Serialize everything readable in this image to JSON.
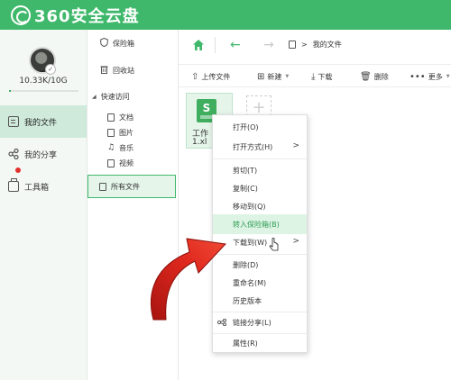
{
  "app": {
    "title": "360安全云盘",
    "brand_color": "#3fb86b"
  },
  "user": {
    "quota": "10.33K/10G",
    "quota_fraction": 0.001
  },
  "nav": {
    "items": [
      {
        "label": "我的文件",
        "icon": "document-icon",
        "active": true
      },
      {
        "label": "我的分享",
        "icon": "share-icon",
        "active": false
      },
      {
        "label": "工具箱",
        "icon": "toolbox-icon",
        "active": false,
        "badge": "red-dot"
      }
    ]
  },
  "tree": {
    "safe": "保险箱",
    "recycle": "回收站",
    "quick_access": "快速访问",
    "categories": [
      "文档",
      "图片",
      "音乐",
      "视频"
    ],
    "all_files": "所有文件"
  },
  "breadcrumb": {
    "current": "我的文件",
    "separator": ">"
  },
  "toolbar": {
    "upload": "上传文件",
    "new": "新建",
    "download": "下载",
    "delete": "删除",
    "more": "更多"
  },
  "file": {
    "name_line1": "工作",
    "name_line2": "1.xl",
    "type": "spreadsheet-icon",
    "type_letter": "S"
  },
  "context_menu": {
    "items": [
      {
        "label": "打开(O)"
      },
      {
        "label": "打开方式(H)",
        "submenu": true
      },
      {
        "label": "剪切(T)"
      },
      {
        "label": "复制(C)"
      },
      {
        "label": "移动到(Q)"
      },
      {
        "label": "转入保险箱(B)",
        "highlighted": true
      },
      {
        "label": "下载到(W)",
        "submenu": true
      },
      {
        "label": "删除(D)"
      },
      {
        "label": "重命名(M)"
      },
      {
        "label": "历史版本"
      },
      {
        "label": "链接分享(L)",
        "icon": "link-share-icon"
      },
      {
        "label": "属性(R)"
      }
    ],
    "submenu_glyph": ">"
  },
  "annotation": {
    "arrow_color": "#d8261d"
  }
}
